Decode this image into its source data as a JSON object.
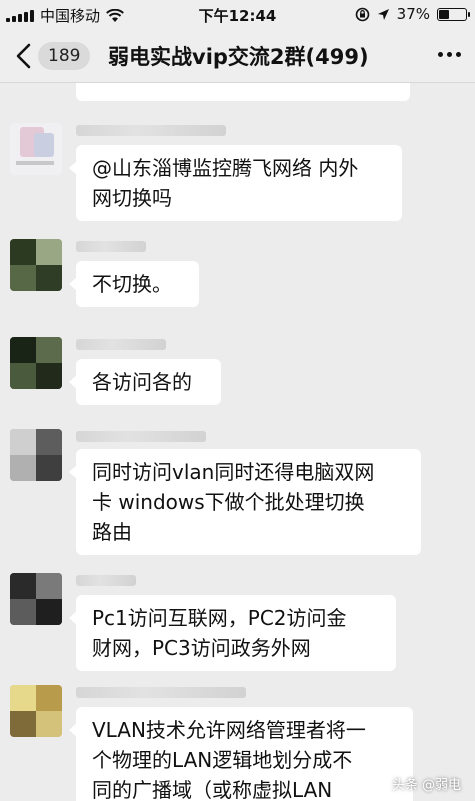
{
  "status_bar": {
    "carrier": "中国移动",
    "time": "下午12:44",
    "battery_percent": "37%",
    "battery_level": 0.37
  },
  "nav": {
    "back_icon": "chevron-left-icon",
    "unread_count": "189",
    "title": "弱电实战vip交流2群(499)",
    "more_icon": "more-dots-icon"
  },
  "messages": [
    {
      "text": ""
    },
    {
      "text": "@山东淄博监控腾飞网络 内外\n网切换吗"
    },
    {
      "text": "不切换。"
    },
    {
      "text": "各访问各的"
    },
    {
      "text": "同时访问vlan同时还得电脑双网\n卡 windows下做个批处理切换\n路由"
    },
    {
      "text": "Pc1访问互联网，PC2访问金\n财网，PC3访问政务外网"
    },
    {
      "text": "VLAN技术允许网络管理者将一\n个物理的LAN逻辑地划分成不\n同的广播域（或称虚拟LAN"
    }
  ],
  "watermark": "头条 @弱电"
}
